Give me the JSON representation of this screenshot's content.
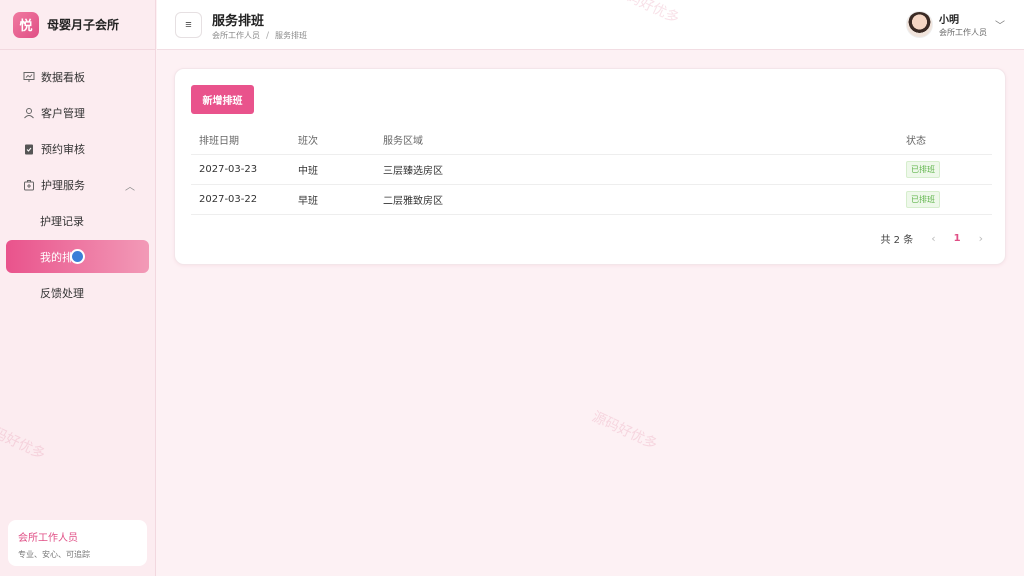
{
  "brand": {
    "logo_char": "悦",
    "name": "母婴月子会所"
  },
  "sidebar": {
    "items": [
      {
        "label": "数据看板",
        "icon": "dashboard-icon"
      },
      {
        "label": "客户管理",
        "icon": "user-icon"
      },
      {
        "label": "预约审核",
        "icon": "clipboard-check-icon"
      },
      {
        "label": "护理服务",
        "icon": "medical-kit-icon",
        "expanded": true
      },
      {
        "label": "护理记录",
        "sub": true
      },
      {
        "label": "我的排",
        "sub": true,
        "active": true
      },
      {
        "label": "反馈处理",
        "sub": true
      }
    ],
    "card": {
      "title": "会所工作人员",
      "subtitle": "专业、安心、可追踪"
    }
  },
  "header": {
    "title": "服务排班",
    "breadcrumb": [
      "会所工作人员",
      "服务排班"
    ],
    "user": {
      "name": "小明",
      "role": "会所工作人员"
    }
  },
  "toolbar": {
    "add_label": "新增排班"
  },
  "table": {
    "columns": [
      "排班日期",
      "班次",
      "服务区域",
      "状态"
    ],
    "rows": [
      {
        "date": "2027-03-23",
        "shift": "中班",
        "area": "三层臻选房区",
        "status": "已排班"
      },
      {
        "date": "2027-03-22",
        "shift": "早班",
        "area": "二层雅致房区",
        "status": "已排班"
      }
    ]
  },
  "pagination": {
    "total_text": "共 2 条",
    "current_page": "1",
    "prev": "‹",
    "next": "›"
  },
  "watermark": "源码好优多",
  "colors": {
    "accent": "#e9538c",
    "status_green": "#5fb44a",
    "bg": "#fdf1f4"
  }
}
